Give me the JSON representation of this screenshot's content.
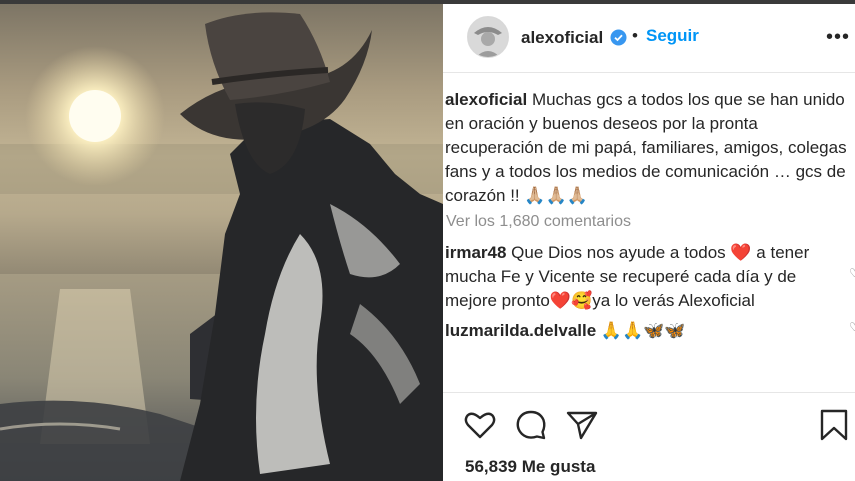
{
  "header": {
    "username": "alexoficial",
    "dot": "•",
    "follow_label": "Seguir",
    "more_label": "•••"
  },
  "caption": {
    "username": "alexoficial",
    "line1": " Muchas gcs a todos los que se han unido",
    "line2": "en oración y buenos deseos por la pronta",
    "line3": "recuperación de mi papá, familiares, amigos, colegas",
    "line4": "fans y a todos los medios de comunicación … gcs de",
    "line5": "corazón !! 🙏🏼🙏🏼🙏🏼"
  },
  "view_comments": "Ver los 1,680 comentarios",
  "comments": [
    {
      "username": "irmar48",
      "text_a": " Que Dios nos ayude a todos ❤️ a tener",
      "text_b": "mucha Fe y Vicente se recuperé cada día y de",
      "text_c": "mejore pronto❤️🥰ya lo verás Alexoficial"
    },
    {
      "username": "luzmarilda.delvalle",
      "text": " 🙏🙏🦋🦋"
    }
  ],
  "icons": [
    "heart-icon",
    "comment-icon",
    "share-icon",
    "bookmark-icon",
    "verified-icon"
  ],
  "likes": "56,839 Me gusta",
  "colors": {
    "accent": "#0095f6",
    "text": "#262626",
    "muted": "#8e8e8e",
    "verified": "#3897f0"
  }
}
